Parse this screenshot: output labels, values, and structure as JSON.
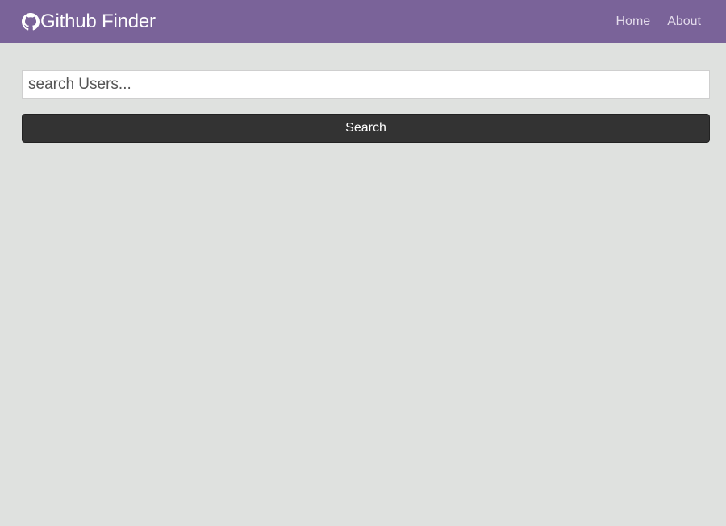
{
  "app": {
    "title": "Github Finder",
    "logo_icon": "github-icon"
  },
  "nav": {
    "links": [
      {
        "label": "Home"
      },
      {
        "label": "About"
      }
    ]
  },
  "search": {
    "placeholder": "search Users...",
    "value": "",
    "button_label": "Search"
  },
  "colors": {
    "navbar_bg": "#7a6399",
    "page_bg": "#dfe1df",
    "button_bg": "#333333",
    "nav_link": "#e3dbeb"
  }
}
